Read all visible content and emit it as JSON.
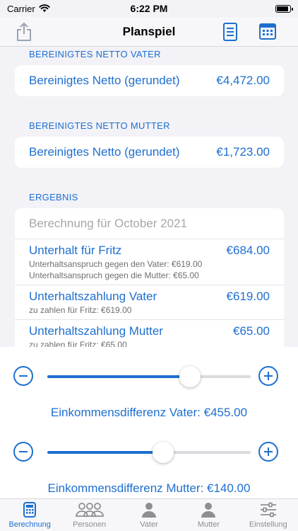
{
  "status_bar": {
    "carrier": "Carrier",
    "time": "6:22 PM"
  },
  "nav": {
    "title": "Planspiel"
  },
  "sections": {
    "netto_vater": {
      "header": "BEREINIGTES NETTO VATER",
      "label": "Bereinigtes Netto (gerundet)",
      "value": "€4,472.00"
    },
    "netto_mutter": {
      "header": "BEREINIGTES NETTO MUTTER",
      "label": "Bereinigtes Netto (gerundet)",
      "value": "€1,723.00"
    },
    "ergebnis": {
      "header": "ERGEBNIS",
      "title": "Berechnung für October 2021",
      "rows": [
        {
          "label": "Unterhalt für Fritz",
          "value": "€684.00",
          "sub1": "Unterhaltsanspruch gegen den Vater: €619.00",
          "sub2": "Unterhaltsanspruch gegen die Mutter: €65.00"
        },
        {
          "label": "Unterhaltszahlung Vater",
          "value": "€619.00",
          "sub1": "zu zahlen für Fritz: €619.00"
        },
        {
          "label": "Unterhaltszahlung Mutter",
          "value": "€65.00",
          "sub1": "zu zahlen für Fritz: €65.00"
        }
      ]
    }
  },
  "sliders": [
    {
      "label": "Einkommensdifferenz Vater: €455.00",
      "fraction": 0.7
    },
    {
      "label": "Einkommensdifferenz Mutter: €140.00",
      "fraction": 0.57
    }
  ],
  "tabs": [
    {
      "label": "Berechnung",
      "icon": "calculator-icon",
      "active": true
    },
    {
      "label": "Personen",
      "icon": "people-icon",
      "active": false
    },
    {
      "label": "Vater",
      "icon": "person-icon",
      "active": false
    },
    {
      "label": "Mutter",
      "icon": "person-icon",
      "active": false
    },
    {
      "label": "Einstellung",
      "icon": "sliders-icon",
      "active": false
    }
  ],
  "colors": {
    "accent": "#1e6fd0",
    "background": "#f2f2f7",
    "secondary_text": "#6f6f74"
  }
}
